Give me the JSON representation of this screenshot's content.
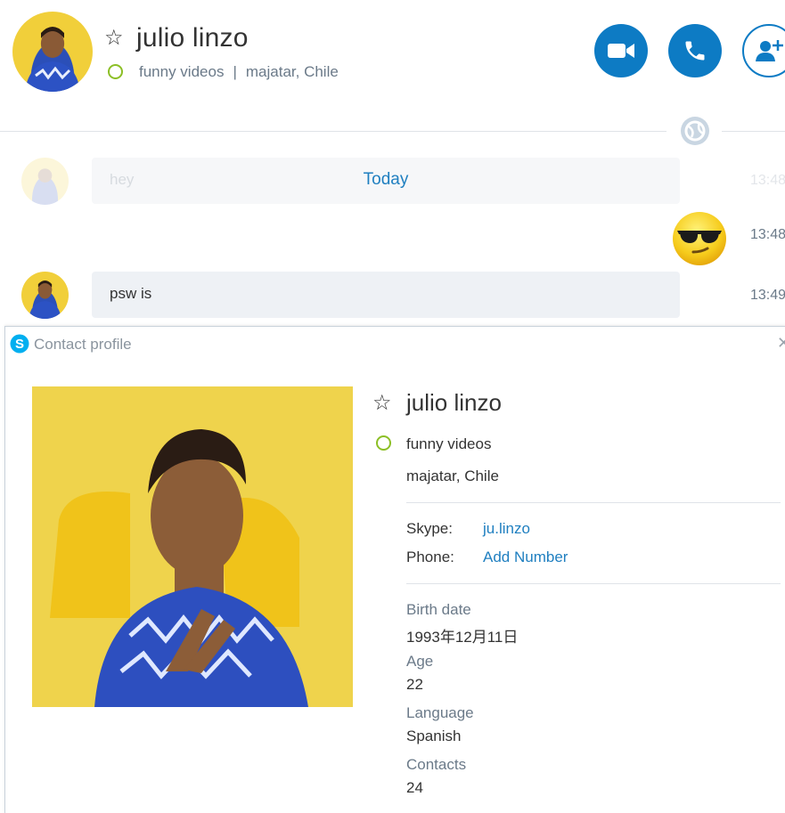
{
  "header": {
    "name": "julio linzo",
    "mood": "funny videos",
    "separator": "|",
    "location": "majatar, Chile"
  },
  "conversation": {
    "day_label": "Today",
    "messages": [
      {
        "text": "hey",
        "time": "13:48"
      },
      {
        "text": "",
        "emoji": "sunglasses-emoji",
        "time": "13:48"
      },
      {
        "text": "psw is",
        "time": "13:49"
      }
    ]
  },
  "profile": {
    "panel_title": "Contact profile",
    "name": "julio linzo",
    "mood": "funny videos",
    "location": "majatar, Chile",
    "skype_label": "Skype:",
    "skype_value": "ju.linzo",
    "phone_label": "Phone:",
    "phone_value": "Add Number",
    "details": [
      {
        "label": "Birth date",
        "value": "1993年12月11日"
      },
      {
        "label": "Age",
        "value": "22"
      },
      {
        "label": "Language",
        "value": "Spanish"
      },
      {
        "label": "Contacts",
        "value": "24"
      }
    ]
  },
  "colors": {
    "accent": "#0d7bc4",
    "link": "#1f7fc0",
    "presence": "#8cbf26"
  },
  "icons": [
    "star-icon",
    "video-call-icon",
    "phone-icon",
    "add-contact-icon",
    "globe-icon",
    "skype-icon",
    "close-icon"
  ]
}
